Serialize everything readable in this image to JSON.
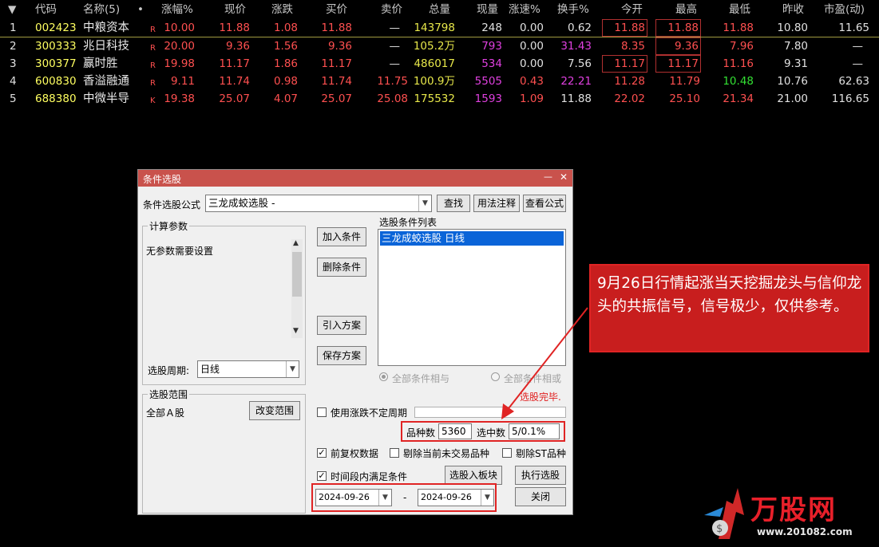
{
  "header": {
    "sort_arrow": "▼",
    "code": "代码",
    "name": "名称(5)",
    "dot": "•",
    "chg_pct": "涨幅%",
    "price": "现价",
    "chg": "涨跌",
    "bid": "买价",
    "ask": "卖价",
    "volume": "总量",
    "cur_vol": "现量",
    "speed": "涨速%",
    "turnover": "换手%",
    "open": "今开",
    "high": "最高",
    "low": "最低",
    "prev_close": "昨收",
    "pe": "市盈(动)"
  },
  "rows": [
    {
      "idx": "1",
      "code": "002423",
      "name": "中粮资本",
      "flag": "R",
      "chg_pct": "10.00",
      "price": "11.88",
      "chg": "1.08",
      "bid": "11.88",
      "ask": "—",
      "volume": "143798",
      "cur_vol": "248",
      "speed": "0.00",
      "turnover": "0.62",
      "open": "11.88",
      "high": "11.88",
      "low": "11.88",
      "prev_close": "10.80",
      "pe": "11.65"
    },
    {
      "idx": "2",
      "code": "300333",
      "name": "兆日科技",
      "flag": "R",
      "chg_pct": "20.00",
      "price": "9.36",
      "chg": "1.56",
      "bid": "9.36",
      "ask": "—",
      "volume": "105.2万",
      "cur_vol": "793",
      "speed": "0.00",
      "turnover": "31.43",
      "open": "8.35",
      "high": "9.36",
      "low": "7.96",
      "prev_close": "7.80",
      "pe": "—"
    },
    {
      "idx": "3",
      "code": "300377",
      "name": "赢时胜",
      "flag": "R",
      "chg_pct": "19.98",
      "price": "11.17",
      "chg": "1.86",
      "bid": "11.17",
      "ask": "—",
      "volume": "486017",
      "cur_vol": "534",
      "speed": "0.00",
      "turnover": "7.56",
      "open": "11.17",
      "high": "11.17",
      "low": "11.16",
      "prev_close": "9.31",
      "pe": "—"
    },
    {
      "idx": "4",
      "code": "600830",
      "name": "香溢融通",
      "flag": "R",
      "chg_pct": "9.11",
      "price": "11.74",
      "chg": "0.98",
      "bid": "11.74",
      "ask": "11.75",
      "volume": "100.9万",
      "cur_vol": "5505",
      "speed": "0.43",
      "turnover": "22.21",
      "open": "11.28",
      "high": "11.79",
      "low": "10.48",
      "prev_close": "10.76",
      "pe": "62.63"
    },
    {
      "idx": "5",
      "code": "688380",
      "name": "中微半导",
      "flag": "K",
      "chg_pct": "19.38",
      "price": "25.07",
      "chg": "4.07",
      "bid": "25.07",
      "ask": "25.08",
      "volume": "175532",
      "cur_vol": "1593",
      "speed": "1.09",
      "turnover": "11.88",
      "open": "22.02",
      "high": "25.10",
      "low": "21.34",
      "prev_close": "21.00",
      "pe": "116.65"
    }
  ],
  "dialog": {
    "title": "条件选股",
    "minimize": "—",
    "close": "✕",
    "formula_label": "条件选股公式",
    "formula_value": "三龙成蛟选股  -",
    "find_btn": "查找",
    "usage_btn": "用法注释",
    "view_btn": "查看公式",
    "params_title": "计算参数",
    "params_text": "无参数需要设置",
    "period_label": "选股周期:",
    "period_value": "日线",
    "scope_title": "选股范围",
    "scope_text": "全部Ａ股",
    "change_scope_btn": "改变范围",
    "add_cond_btn": "加入条件",
    "del_cond_btn": "删除条件",
    "import_btn": "引入方案",
    "save_btn": "保存方案",
    "cond_list_title": "选股条件列表",
    "cond_items": [
      "三龙成蛟选股  日线"
    ],
    "radio_and": "全部条件相与",
    "radio_or": "全部条件相或",
    "status": "选股完毕.",
    "use_irregular": "使用涨跌不定周期",
    "count_label": "品种数",
    "count_value": "5360",
    "selected_label": "选中数",
    "selected_value": "5/0.1%",
    "forward_adj": "前复权数据",
    "exclude_untraded": "剔除当前未交易品种",
    "exclude_st": "剔除ST品种",
    "time_range": "时间段内满足条件",
    "to_block_btn": "选股入板块",
    "execute_btn": "执行选股",
    "close_btn": "关闭",
    "date_from": "2024-09-26",
    "date_sep": "-",
    "date_to": "2024-09-26"
  },
  "annotation": "9月26日行情起涨当天挖掘龙头与信仰龙头的共振信号，信号极少，仅供参考。",
  "watermark": {
    "name": "万股网",
    "url": "www.201082.com"
  },
  "colors": {
    "up": "#ff5050",
    "down": "#33e033",
    "neutral": "#e0e0e0",
    "volume": "#e8e84a",
    "code": "#ffff60",
    "magenta": "#e040e0",
    "title_bar": "#c9524c",
    "annotation": "#ffffff",
    "annotation_bg": "#c81e1e"
  }
}
